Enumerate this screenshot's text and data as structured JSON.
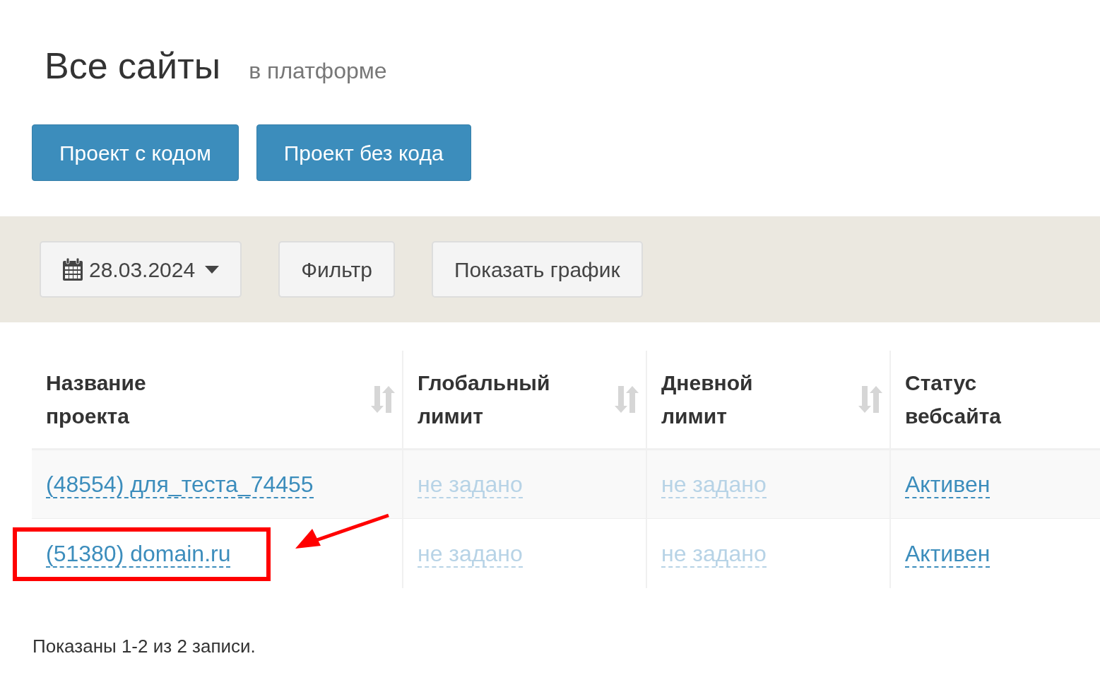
{
  "header": {
    "title": "Все сайты",
    "subtitle": "в платформе"
  },
  "actions": [
    {
      "label": "Проект с кодом"
    },
    {
      "label": "Проект без кода"
    }
  ],
  "filters": {
    "date": "28.03.2024",
    "filter_button": "Фильтр",
    "chart_button": "Показать график"
  },
  "table": {
    "columns": [
      {
        "label": "Название проекта",
        "sortable": true
      },
      {
        "label": "Глобальный лимит",
        "sortable": true
      },
      {
        "label": "Дневной лимит",
        "sortable": true
      },
      {
        "label": "Статус вебсайта",
        "sortable": false
      }
    ],
    "rows": [
      {
        "highlighted": false,
        "cells": [
          {
            "text": "(48554) для_теста_74455",
            "muted": false
          },
          {
            "text": "не задано",
            "muted": true
          },
          {
            "text": "не задано",
            "muted": true
          },
          {
            "text": "Активен",
            "muted": false
          }
        ]
      },
      {
        "highlighted": true,
        "cells": [
          {
            "text": "(51380) domain.ru",
            "muted": false
          },
          {
            "text": "не задано",
            "muted": true
          },
          {
            "text": "не задано",
            "muted": true
          },
          {
            "text": "Активен",
            "muted": false
          }
        ]
      }
    ]
  },
  "summary": "Показаны 1-2 из 2 записи."
}
